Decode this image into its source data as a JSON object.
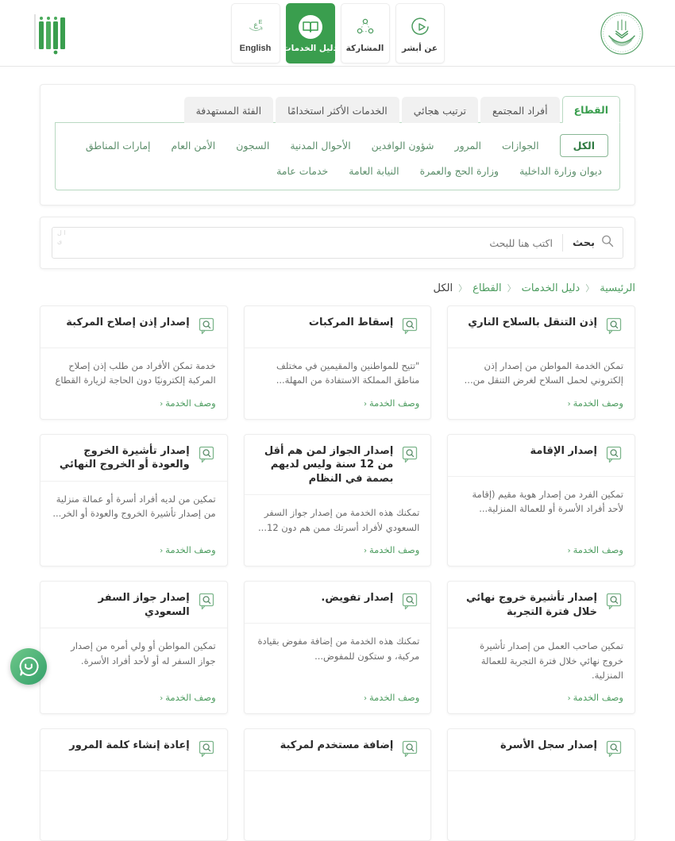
{
  "header": {
    "moi_seal_name": "ministry-of-interior-seal",
    "absher_logo_name": "absher-logo",
    "nav_tiles": [
      {
        "label": "عن أبشر",
        "icon": "about-play-icon",
        "active": false
      },
      {
        "label": "المشاركة",
        "icon": "share-network-icon",
        "active": false
      },
      {
        "label": "دليل الخدمات",
        "icon": "open-book-icon",
        "active": true
      },
      {
        "label": "English",
        "icon": "language-globe-icon",
        "active": false
      }
    ]
  },
  "filters": {
    "tabs": [
      {
        "label": "القطاع",
        "active": true
      },
      {
        "label": "أفراد المجتمع",
        "active": false
      },
      {
        "label": "ترتيب هجائي",
        "active": false
      },
      {
        "label": "الخدمات الأكثر استخدامًا",
        "active": false
      },
      {
        "label": "الفئة المستهدفة",
        "active": false
      }
    ],
    "sectors_row1": [
      {
        "label": "الكل",
        "selected": true
      },
      {
        "label": "الجوازات",
        "selected": false
      },
      {
        "label": "المرور",
        "selected": false
      },
      {
        "label": "شؤون الوافدين",
        "selected": false
      },
      {
        "label": "الأحوال المدنية",
        "selected": false
      },
      {
        "label": "السجون",
        "selected": false
      },
      {
        "label": "الأمن العام",
        "selected": false
      },
      {
        "label": "إمارات المناطق",
        "selected": false
      }
    ],
    "sectors_row2": [
      {
        "label": "ديوان وزارة الداخلية",
        "selected": false
      },
      {
        "label": "وزارة الحج والعمرة",
        "selected": false
      },
      {
        "label": "النيابة العامة",
        "selected": false
      },
      {
        "label": "خدمات عامة",
        "selected": false
      }
    ]
  },
  "search": {
    "button_label": "بحث",
    "placeholder": "اكتب هنا للبحث",
    "value": "",
    "icon": "search-icon",
    "ghost_text": "ا\nل\nى"
  },
  "breadcrumb": [
    {
      "label": "الرئيسية",
      "current": false
    },
    {
      "label": "دليل الخدمات",
      "current": false
    },
    {
      "label": "القطاع",
      "current": false
    },
    {
      "label": "الكل",
      "current": true
    }
  ],
  "breadcrumb_separator": "〈",
  "cards": [
    {
      "title": "إذن التنقل بالسلاح الناري",
      "desc": "تمكن الخدمة المواطن من إصدار إذن إلكتروني لحمل السلاح لغرض التنقل من...",
      "link": "وصف الخدمة"
    },
    {
      "title": "إسقاط المركبات",
      "desc": "\"تتيح للمواطنين والمقيمين في مختلف مناطق المملكة الاستفادة من المهلة...",
      "link": "وصف الخدمة"
    },
    {
      "title": "إصدار إذن إصلاح المركبة",
      "desc": "خدمة تمكن الأفراد من طلب إذن إصلاح المركبة إلكترونيًا دون الحاجة لزيارة القطاع",
      "link": "وصف الخدمة"
    },
    {
      "title": "إصدار الإقامة",
      "desc": "تمكين الفرد من إصدار هوية مقيم (إقامة لأحد أفراد الأسرة أو للعمالة المنزلية...",
      "link": "وصف الخدمة"
    },
    {
      "title": "إصدار الجواز لمن هم أقل من 12 سنة وليس لديهم بصمة في النظام",
      "desc": "تمكنك هذه الخدمة من إصدار جواز السفر السعودي لأفراد أسرتك ممن هم دون 12...",
      "link": "وصف الخدمة"
    },
    {
      "title": "إصدار تأشيرة الخروج والعودة أو الخروج النهائي",
      "desc": "تمكين من لديه أفراد أسرة أو عمالة منزلية من إصدار تأشيرة الخروج والعودة أو الخر...",
      "link": "وصف الخدمة"
    },
    {
      "title": "إصدار تأشيرة خروج نهائي خلال فترة التجربة",
      "desc": "تمكين صاحب العمل من إصدار تأشيرة خروج نهائي خلال فترة التجربة للعمالة المنزلية.",
      "link": "وصف الخدمة"
    },
    {
      "title": "إصدار تفويض.",
      "desc": "تمكنك هذه الخدمة من إضافة مفوض بقيادة مركبة، و ستكون للمفوض...",
      "link": "وصف الخدمة"
    },
    {
      "title": "إصدار جواز السفر السعودي",
      "desc": "تمكين المواطن أو ولي أمره من إصدار جواز السفر له أو لأحد أفراد الأسرة.",
      "link": "وصف الخدمة"
    },
    {
      "title": "إصدار سجل الأسرة",
      "desc": "",
      "link": ""
    },
    {
      "title": "إضافة مستخدم لمركبة",
      "desc": "",
      "link": ""
    },
    {
      "title": "إعادة إنشاء كلمة المرور",
      "desc": "",
      "link": ""
    }
  ],
  "chat_fab": {
    "icon": "chat-smiley-icon"
  },
  "colors": {
    "brand_green": "#3a9e4e",
    "link_green": "#4c9c5f",
    "panel_border": "#b9d9c2",
    "tab_inactive_bg": "#f1f1f1"
  }
}
